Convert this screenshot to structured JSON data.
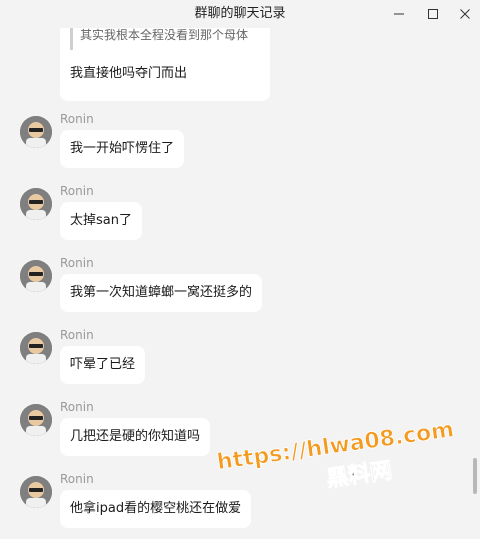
{
  "window": {
    "title": "群聊的聊天记录"
  },
  "quoted_message": {
    "quote": "其实我根本全程没看到那个母体",
    "reply": "我直接他吗夺门而出"
  },
  "messages": [
    {
      "sender": "Ronin",
      "text": "我一开始吓愣住了"
    },
    {
      "sender": "Ronin",
      "text": "太掉san了"
    },
    {
      "sender": "Ronin",
      "text": "我第一次知道蟑螂一窝还挺多的"
    },
    {
      "sender": "Ronin",
      "text": "吓晕了已经"
    },
    {
      "sender": "Ronin",
      "text": "几把还是硬的你知道吗"
    },
    {
      "sender": "Ronin",
      "text": "他拿ipad看的樱空桃还在做爱"
    }
  ],
  "watermark": {
    "url": "https://hlwa08.com",
    "name": "黑料网"
  },
  "colors": {
    "background": "#f3f3f3",
    "bubble": "#ffffff",
    "watermark_orange": "#f39a1f",
    "watermark_black": "#1a1a1a"
  }
}
